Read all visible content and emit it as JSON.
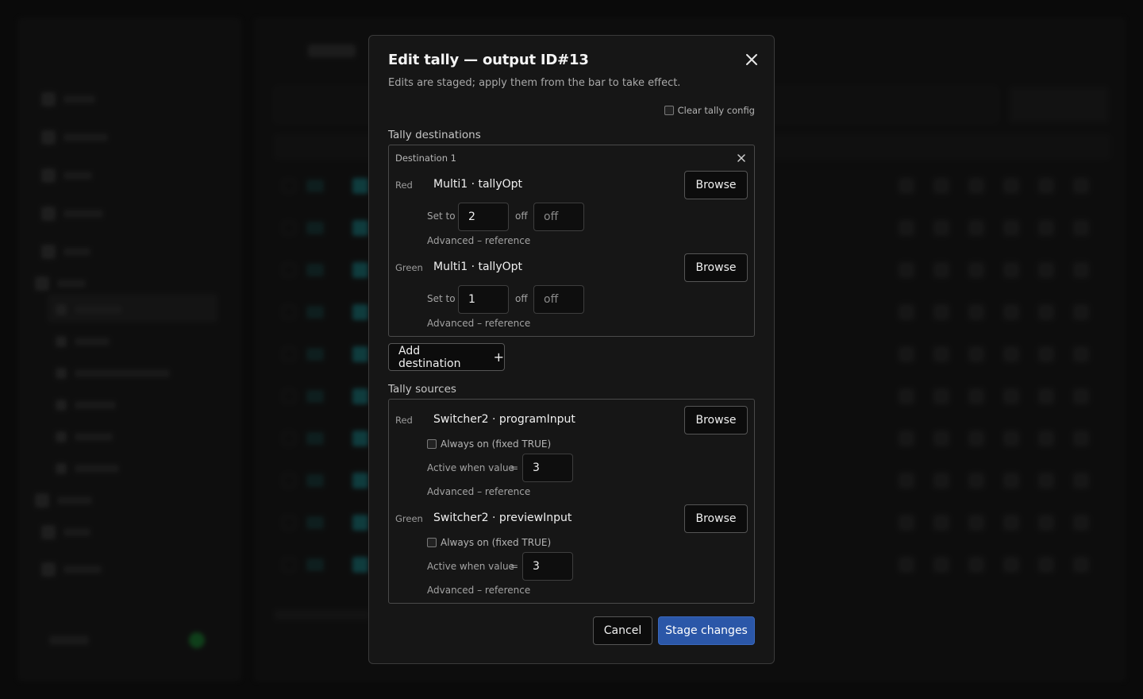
{
  "dialog": {
    "title": "Edit tally — output ID#13",
    "subtitle": "Edits are staged; apply them from the bar to take effect.",
    "clear_label": "Clear tally config",
    "destinations_label": "Tally destinations",
    "sources_label": "Tally sources",
    "add_destination_label": "Add destination",
    "add_icon": "+",
    "cancel_label": "Cancel",
    "stage_label": "Stage changes",
    "close_icon": "close-icon"
  },
  "destination": {
    "header": "Destination 1",
    "rows": [
      {
        "color": "Red",
        "path": "Multi1 · tallyOpt",
        "browse": "Browse",
        "set_to_label": "Set to",
        "set_to_value": "2",
        "off_label": "off",
        "off_placeholder": "off",
        "advanced": "Advanced – reference"
      },
      {
        "color": "Green",
        "path": "Multi1 · tallyOpt",
        "browse": "Browse",
        "set_to_label": "Set to",
        "set_to_value": "1",
        "off_label": "off",
        "off_placeholder": "off",
        "advanced": "Advanced – reference"
      }
    ]
  },
  "sources": {
    "rows": [
      {
        "color": "Red",
        "path": "Switcher2 · programInput",
        "browse": "Browse",
        "always_label": "Always on (fixed TRUE)",
        "active_label": "Active when value",
        "equals": "=",
        "active_value": "3",
        "advanced": "Advanced – reference"
      },
      {
        "color": "Green",
        "path": "Switcher2 · previewInput",
        "browse": "Browse",
        "always_label": "Always on (fixed TRUE)",
        "active_label": "Active when value",
        "equals": "=",
        "active_value": "3",
        "advanced": "Advanced – reference"
      }
    ]
  },
  "colors": {
    "primary": "#2b57a8",
    "status_online": "#1fa53e",
    "teal_tag": "#1d9aa0"
  }
}
